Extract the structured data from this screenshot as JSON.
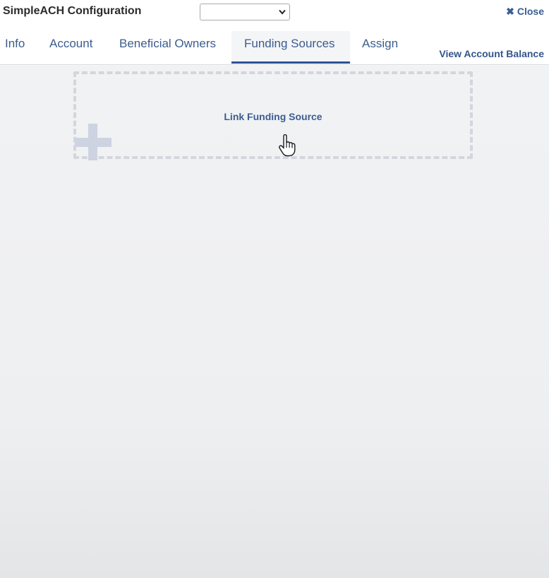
{
  "header": {
    "title": "SimpleACH Configuration",
    "account_select_value": "",
    "close_label": "Close",
    "close_glyph": "✖"
  },
  "tabs": [
    {
      "label": "Info",
      "active": false
    },
    {
      "label": "Account",
      "active": false
    },
    {
      "label": "Beneficial Owners",
      "active": false
    },
    {
      "label": "Funding Sources",
      "active": true
    },
    {
      "label": "Assign",
      "active": false
    }
  ],
  "actions": {
    "view_account_balance": "View Account Balance"
  },
  "main": {
    "link_funding_source": "Link Funding Source"
  },
  "colors": {
    "link_blue": "#3b5d8f",
    "active_tab_underline": "#2b5296",
    "dashed_border": "#d3d6dd",
    "plus_icon": "#cdd3e1"
  },
  "icons": {
    "close": "close-icon",
    "select": "chevron-down-icon",
    "add": "plus-icon",
    "cursor": "hand-pointer-cursor"
  }
}
